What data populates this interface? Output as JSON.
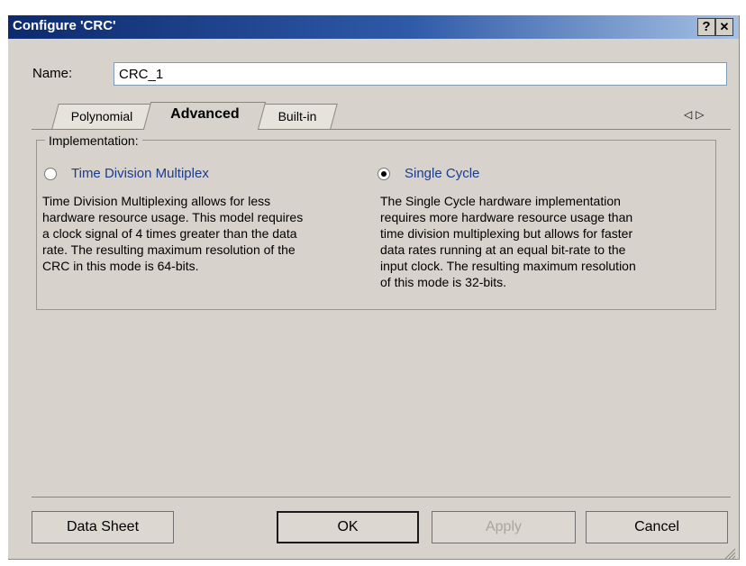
{
  "window": {
    "title": "Configure 'CRC'",
    "help_label": "?",
    "close_label": "✕"
  },
  "name_field": {
    "label": "Name:",
    "value": "CRC_1"
  },
  "tabs": [
    {
      "label": "Polynomial",
      "active": false
    },
    {
      "label": "Advanced",
      "active": true
    },
    {
      "label": "Built-in",
      "active": false
    }
  ],
  "tab_scroll": {
    "left": "◁",
    "right": "▷"
  },
  "implementation": {
    "title": "Implementation:",
    "options": [
      {
        "label": "Time Division Multiplex",
        "selected": false,
        "description": "Time Division Multiplexing allows for less\nhardware resource usage.  This model requires\na clock signal of 4 times greater than the data\nrate.  The  resulting maximum resolution of the\nCRC in this mode is 64-bits."
      },
      {
        "label": "Single Cycle",
        "selected": true,
        "description": "The Single Cycle hardware implementation\nrequires more hardware resource usage than\ntime division multiplexing but allows for faster\ndata rates running at an equal bit-rate to the\ninput clock.  The resulting maximum resolution\nof this mode is 32-bits."
      }
    ]
  },
  "buttons": {
    "datasheet": "Data Sheet",
    "ok": "OK",
    "apply": "Apply",
    "cancel": "Cancel"
  },
  "colors": {
    "title_gradient_start": "#0d2a6e",
    "title_gradient_end": "#a6c1e3",
    "dialog_bg": "#d7d2cb",
    "radio_label": "#1a3d8f"
  }
}
